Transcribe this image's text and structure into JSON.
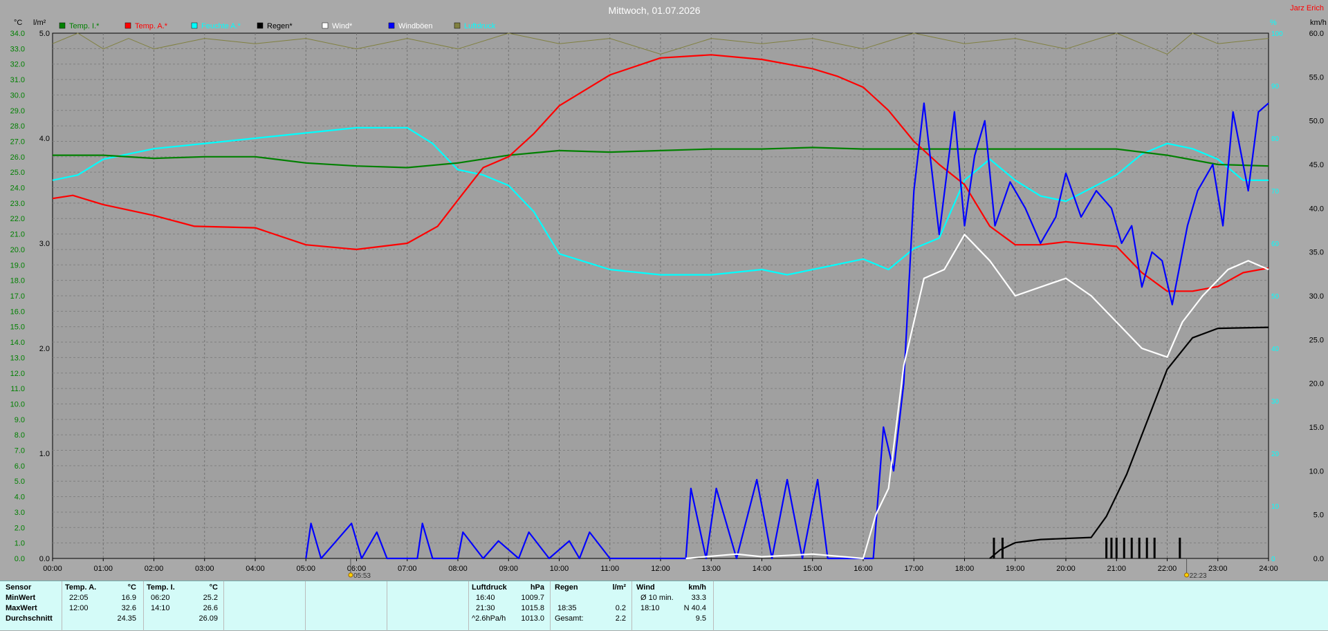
{
  "page_title": "Mittwoch, 01.07.2026",
  "author": "Jarz Erich",
  "units": {
    "left_temp": "°C",
    "left_rain": "l/m²",
    "right_pct": "%",
    "right_wind": "km/h"
  },
  "legend": [
    {
      "label": "Temp. I.*",
      "color": "#008000"
    },
    {
      "label": "Temp. A.*",
      "color": "#ff0000"
    },
    {
      "label": "Feuchte A.*",
      "color": "#00ffff"
    },
    {
      "label": "Regen*",
      "color": "#000000"
    },
    {
      "label": "Wind*",
      "color": "#ffffff"
    },
    {
      "label": "Windböen",
      "color": "#0000ff"
    },
    {
      "label": "Luftdruck",
      "color": "#808040"
    }
  ],
  "markers": {
    "sunrise": "05:53",
    "sunset": "22:23"
  },
  "chart_data": {
    "type": "line",
    "x_unit": "time of day",
    "xlim": [
      "00:00",
      "24:00"
    ],
    "x_ticks": [
      "00:00",
      "01:00",
      "02:00",
      "03:00",
      "04:00",
      "05:00",
      "06:00",
      "07:00",
      "08:00",
      "09:00",
      "10:00",
      "11:00",
      "12:00",
      "13:00",
      "14:00",
      "15:00",
      "16:00",
      "17:00",
      "18:00",
      "19:00",
      "20:00",
      "21:00",
      "22:00",
      "23:00",
      "24:00"
    ],
    "y_temp_ticks": [
      "0.0",
      "1.0",
      "2.0",
      "3.0",
      "4.0",
      "5.0",
      "6.0",
      "7.0",
      "8.0",
      "9.0",
      "10.0",
      "11.0",
      "12.0",
      "13.0",
      "14.0",
      "15.0",
      "16.0",
      "17.0",
      "18.0",
      "19.0",
      "20.0",
      "21.0",
      "22.0",
      "23.0",
      "24.0",
      "25.0",
      "26.0",
      "27.0",
      "28.0",
      "29.0",
      "30.0",
      "31.0",
      "32.0",
      "33.0",
      "34.0"
    ],
    "y_rain_ticks": [
      "0.0",
      "1.0",
      "2.0",
      "3.0",
      "4.0",
      "5.0"
    ],
    "y_pct_ticks": [
      "0",
      "10",
      "20",
      "30",
      "40",
      "50",
      "60",
      "70",
      "80",
      "90",
      "100"
    ],
    "y_wind_ticks": [
      "0.0",
      "5.0",
      "10.0",
      "15.0",
      "20.0",
      "25.0",
      "30.0",
      "35.0",
      "40.0",
      "45.0",
      "50.0",
      "55.0",
      "60.0"
    ],
    "series": [
      {
        "name": "Temp. I.*",
        "axis": "temp",
        "color": "#008000",
        "points": [
          [
            0,
            26.1
          ],
          [
            1,
            26.1
          ],
          [
            2,
            25.9
          ],
          [
            3,
            26.0
          ],
          [
            4,
            26.0
          ],
          [
            5,
            25.6
          ],
          [
            6,
            25.4
          ],
          [
            7,
            25.3
          ],
          [
            8,
            25.6
          ],
          [
            9,
            26.1
          ],
          [
            10,
            26.4
          ],
          [
            11,
            26.3
          ],
          [
            12,
            26.4
          ],
          [
            13,
            26.5
          ],
          [
            14,
            26.5
          ],
          [
            15,
            26.6
          ],
          [
            16,
            26.5
          ],
          [
            17,
            26.5
          ],
          [
            18,
            26.5
          ],
          [
            19,
            26.5
          ],
          [
            20,
            26.5
          ],
          [
            21,
            26.5
          ],
          [
            22,
            26.1
          ],
          [
            23,
            25.5
          ],
          [
            24,
            25.4
          ]
        ]
      },
      {
        "name": "Temp. A.*",
        "axis": "temp",
        "color": "#ff0000",
        "points": [
          [
            0,
            23.3
          ],
          [
            0.4,
            23.5
          ],
          [
            1,
            22.9
          ],
          [
            2,
            22.2
          ],
          [
            2.8,
            21.5
          ],
          [
            4,
            21.4
          ],
          [
            5,
            20.3
          ],
          [
            6,
            20.0
          ],
          [
            7,
            20.4
          ],
          [
            7.6,
            21.5
          ],
          [
            8,
            23.2
          ],
          [
            8.5,
            25.3
          ],
          [
            9,
            26.0
          ],
          [
            9.5,
            27.5
          ],
          [
            10,
            29.3
          ],
          [
            11,
            31.3
          ],
          [
            12,
            32.4
          ],
          [
            13,
            32.6
          ],
          [
            14,
            32.3
          ],
          [
            15,
            31.7
          ],
          [
            15.5,
            31.2
          ],
          [
            16,
            30.5
          ],
          [
            16.5,
            29.0
          ],
          [
            17,
            27.0
          ],
          [
            17.5,
            25.5
          ],
          [
            18,
            24.2
          ],
          [
            18.5,
            21.5
          ],
          [
            19,
            20.3
          ],
          [
            19.5,
            20.3
          ],
          [
            20,
            20.5
          ],
          [
            21,
            20.2
          ],
          [
            21.5,
            18.5
          ],
          [
            22,
            17.3
          ],
          [
            22.5,
            17.3
          ],
          [
            23,
            17.6
          ],
          [
            23.5,
            18.5
          ],
          [
            24,
            18.8
          ]
        ]
      },
      {
        "name": "Feuchte A.*",
        "axis": "pct",
        "color": "#00ffff",
        "points": [
          [
            0,
            72
          ],
          [
            0.5,
            73
          ],
          [
            1,
            76
          ],
          [
            2,
            78
          ],
          [
            3,
            79
          ],
          [
            4,
            80
          ],
          [
            5,
            81
          ],
          [
            6,
            82
          ],
          [
            7,
            82
          ],
          [
            7.5,
            79
          ],
          [
            8,
            74
          ],
          [
            8.5,
            73
          ],
          [
            9,
            71
          ],
          [
            9.5,
            66
          ],
          [
            10,
            58
          ],
          [
            11,
            55
          ],
          [
            12,
            54
          ],
          [
            13,
            54
          ],
          [
            14,
            55
          ],
          [
            14.5,
            54
          ],
          [
            15,
            55
          ],
          [
            16,
            57
          ],
          [
            16.5,
            55
          ],
          [
            17,
            59
          ],
          [
            17.5,
            61
          ],
          [
            18,
            72
          ],
          [
            18.5,
            76
          ],
          [
            19,
            72
          ],
          [
            19.5,
            69
          ],
          [
            20,
            68
          ],
          [
            21,
            73
          ],
          [
            21.5,
            77
          ],
          [
            22,
            79
          ],
          [
            22.5,
            78
          ],
          [
            23,
            76
          ],
          [
            23.5,
            72
          ],
          [
            24,
            72
          ]
        ]
      },
      {
        "name": "Wind*",
        "axis": "wind",
        "color": "#ffffff",
        "points": [
          [
            12.5,
            0
          ],
          [
            13.5,
            0.5
          ],
          [
            14,
            0.2
          ],
          [
            15,
            0.5
          ],
          [
            16,
            0
          ],
          [
            16.25,
            5
          ],
          [
            16.5,
            8
          ],
          [
            16.8,
            22
          ],
          [
            17.2,
            32
          ],
          [
            17.6,
            33
          ],
          [
            18,
            37
          ],
          [
            18.5,
            34
          ],
          [
            19,
            30
          ],
          [
            19.5,
            31
          ],
          [
            20,
            32
          ],
          [
            20.5,
            30
          ],
          [
            21,
            27
          ],
          [
            21.5,
            24
          ],
          [
            22,
            23
          ],
          [
            22.3,
            27
          ],
          [
            22.7,
            30
          ],
          [
            23.2,
            33
          ],
          [
            23.6,
            34
          ],
          [
            24,
            33
          ]
        ]
      },
      {
        "name": "Windböen",
        "axis": "wind",
        "color": "#0000ff",
        "points": [
          [
            5,
            0
          ],
          [
            5.1,
            4
          ],
          [
            5.3,
            0
          ],
          [
            5.6,
            2
          ],
          [
            5.9,
            4
          ],
          [
            6.1,
            0
          ],
          [
            6.4,
            3
          ],
          [
            6.6,
            0
          ],
          [
            7.2,
            0
          ],
          [
            7.3,
            4
          ],
          [
            7.5,
            0
          ],
          [
            8,
            0
          ],
          [
            8.1,
            3
          ],
          [
            8.5,
            0
          ],
          [
            8.8,
            2
          ],
          [
            9.2,
            0
          ],
          [
            9.4,
            3
          ],
          [
            9.8,
            0
          ],
          [
            10.2,
            2
          ],
          [
            10.4,
            0
          ],
          [
            10.6,
            3
          ],
          [
            11,
            0
          ],
          [
            12.5,
            0
          ],
          [
            12.6,
            8
          ],
          [
            12.9,
            0
          ],
          [
            13.1,
            8
          ],
          [
            13.5,
            0
          ],
          [
            13.9,
            9
          ],
          [
            14.2,
            0
          ],
          [
            14.5,
            9
          ],
          [
            14.8,
            0
          ],
          [
            15.1,
            9
          ],
          [
            15.3,
            0
          ],
          [
            16.2,
            0
          ],
          [
            16.4,
            15
          ],
          [
            16.6,
            10
          ],
          [
            16.8,
            20
          ],
          [
            17.0,
            42
          ],
          [
            17.2,
            52
          ],
          [
            17.5,
            37
          ],
          [
            17.8,
            51
          ],
          [
            18.0,
            38
          ],
          [
            18.2,
            46
          ],
          [
            18.4,
            50
          ],
          [
            18.6,
            38
          ],
          [
            18.9,
            43
          ],
          [
            19.2,
            40
          ],
          [
            19.5,
            36
          ],
          [
            19.8,
            39
          ],
          [
            20.0,
            44
          ],
          [
            20.3,
            39
          ],
          [
            20.6,
            42
          ],
          [
            20.9,
            40
          ],
          [
            21.1,
            36
          ],
          [
            21.3,
            38
          ],
          [
            21.5,
            31
          ],
          [
            21.7,
            35
          ],
          [
            21.9,
            34
          ],
          [
            22.1,
            29
          ],
          [
            22.4,
            38
          ],
          [
            22.6,
            42
          ],
          [
            22.9,
            45
          ],
          [
            23.1,
            38
          ],
          [
            23.3,
            51
          ],
          [
            23.6,
            42
          ],
          [
            23.8,
            51
          ],
          [
            24,
            52
          ]
        ]
      },
      {
        "name": "Regen*",
        "axis": "rain",
        "color": "#000000",
        "points": [
          [
            18.5,
            0
          ],
          [
            18.7,
            0.08
          ],
          [
            19,
            0.15
          ],
          [
            19.5,
            0.18
          ],
          [
            20.5,
            0.2
          ],
          [
            20.8,
            0.4
          ],
          [
            21.2,
            0.8
          ],
          [
            21.6,
            1.3
          ],
          [
            22,
            1.8
          ],
          [
            22.5,
            2.1
          ],
          [
            23,
            2.19
          ],
          [
            24,
            2.2
          ]
        ]
      },
      {
        "name": "Luftdruck",
        "axis": "pct",
        "color": "#808040",
        "points": [
          [
            0,
            98
          ],
          [
            0.5,
            100
          ],
          [
            1,
            97
          ],
          [
            1.5,
            99
          ],
          [
            2,
            97
          ],
          [
            3,
            99
          ],
          [
            4,
            98
          ],
          [
            5,
            99
          ],
          [
            6,
            97
          ],
          [
            7,
            99
          ],
          [
            8,
            97
          ],
          [
            9,
            100
          ],
          [
            10,
            98
          ],
          [
            11,
            99
          ],
          [
            12,
            96
          ],
          [
            13,
            99
          ],
          [
            14,
            98
          ],
          [
            15,
            99
          ],
          [
            16,
            97
          ],
          [
            17,
            100
          ],
          [
            18,
            98
          ],
          [
            19,
            99
          ],
          [
            20,
            97
          ],
          [
            21,
            100
          ],
          [
            22,
            96
          ],
          [
            22.5,
            100
          ],
          [
            23,
            98
          ],
          [
            24,
            99
          ]
        ]
      }
    ],
    "rain_bars_hours": [
      18.58,
      18.75,
      20.8,
      20.9,
      21.0,
      21.15,
      21.3,
      21.45,
      21.6,
      21.75,
      22.25
    ],
    "grid": true
  },
  "stats": {
    "sensor": {
      "header": "Sensor",
      "rows": [
        "MinWert",
        "MaxWert",
        "Durchschnitt"
      ]
    },
    "temp_a": {
      "header": "Temp. A.",
      "unit": "°C",
      "min_time": "22:05",
      "min_val": "16.9",
      "max_time": "12:00",
      "max_val": "32.6",
      "avg": "24.35"
    },
    "temp_i": {
      "header": "Temp. I.",
      "unit": "°C",
      "min_time": "06:20",
      "min_val": "25.2",
      "max_time": "14:10",
      "max_val": "26.6",
      "avg": "26.09"
    },
    "pressure": {
      "header": "Luftdruck",
      "unit": "hPa",
      "min_time": "16:40",
      "min_val": "1009.7",
      "max_time": "21:30",
      "max_val": "1015.8",
      "avg_time": "^2.6hPa/h",
      "avg": "1013.0"
    },
    "rain": {
      "header": "Regen",
      "unit": "l/m²",
      "max_time": "18:35",
      "max_val": "0.2",
      "total_label": "Gesamt:",
      "total": "2.2"
    },
    "wind": {
      "header": "Wind",
      "unit": "km/h",
      "min_time": "Ø 10 min.",
      "min_val": "33.3",
      "max_time": "18:10",
      "max_val": "N 40.4",
      "avg": "9.5"
    }
  }
}
